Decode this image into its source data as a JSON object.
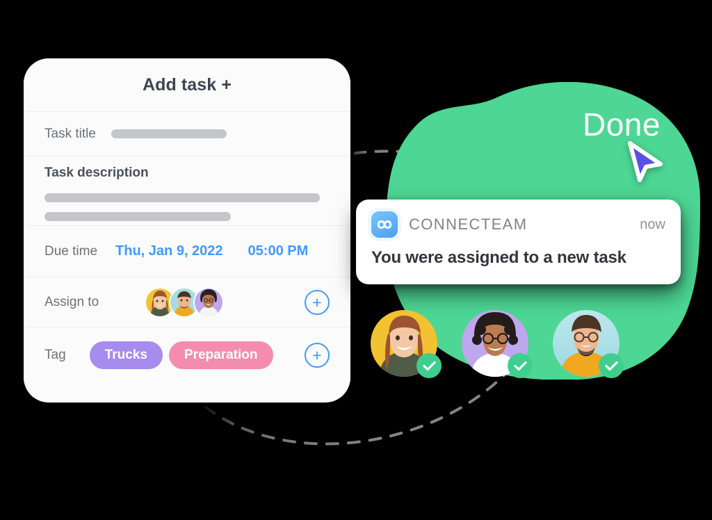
{
  "colors": {
    "blob_green": "#4DD694",
    "accent_blue": "#3F9AFC",
    "badge_green": "#3ECF8E",
    "cursor_purple": "#5B4FE9",
    "tag_purple": "#A78BEF",
    "tag_pink": "#F48CAF",
    "label_gray": "#6C7279",
    "bar_gray": "#C4C6C9",
    "card_bg": "#FBFBFB"
  },
  "task_card": {
    "header_title": "Add task +",
    "rows": {
      "task_title": {
        "label": "Task title",
        "value_placeholder_bar": true
      },
      "task_description": {
        "label": "Task description",
        "value_placeholder_bars": 2
      },
      "due_time": {
        "label": "Due time",
        "date": "Thu, Jan 9, 2022",
        "time": "05:00 PM"
      },
      "assign_to": {
        "label": "Assign to",
        "add_button": "+",
        "avatars": [
          {
            "name": "assignee-1",
            "bg": "#F2C230",
            "skin": "#F2C6A8",
            "hair": "#8C4A2F",
            "shirt": "#4D5B47"
          },
          {
            "name": "assignee-2",
            "bg": "#A8DCE5",
            "skin": "#EBB68F",
            "hair": "#4A3527",
            "shirt": "#F0A81E"
          },
          {
            "name": "assignee-3",
            "bg": "#BFA6EE",
            "skin": "#B9774E",
            "hair": "#2B2220",
            "shirt": "#F4F4F4"
          }
        ]
      },
      "tag": {
        "label": "Tag",
        "add_button": "+",
        "tags": [
          {
            "label": "Trucks",
            "color": "#A78BEF"
          },
          {
            "label": "Preparation",
            "color": "#F48CAF"
          }
        ]
      }
    }
  },
  "done_overlay": {
    "label": "Done",
    "cursor_icon": "pointer-arrow-cursor"
  },
  "notification": {
    "app_icon": "connecteam-infinity-logo",
    "brand": "CONNECTEAM",
    "timestamp": "now",
    "message": "You were assigned to a new task"
  },
  "confirmed_avatars": [
    {
      "name": "confirmed-avatar-1",
      "bg": "#F2C230",
      "skin": "#F4C8A6",
      "hair": "#9E5430",
      "shirt": "#4D5B47",
      "check": "✓"
    },
    {
      "name": "confirmed-avatar-2",
      "bg": "#BFA6EE",
      "skin": "#BC7B50",
      "hair": "#241C1A",
      "shirt": "#FFFFFF",
      "check": "✓"
    },
    {
      "name": "confirmed-avatar-3",
      "bg": "#A8DCE5",
      "skin": "#EDB78F",
      "hair": "#4A3527",
      "shirt": "#F0A81E",
      "check": "✓"
    }
  ]
}
